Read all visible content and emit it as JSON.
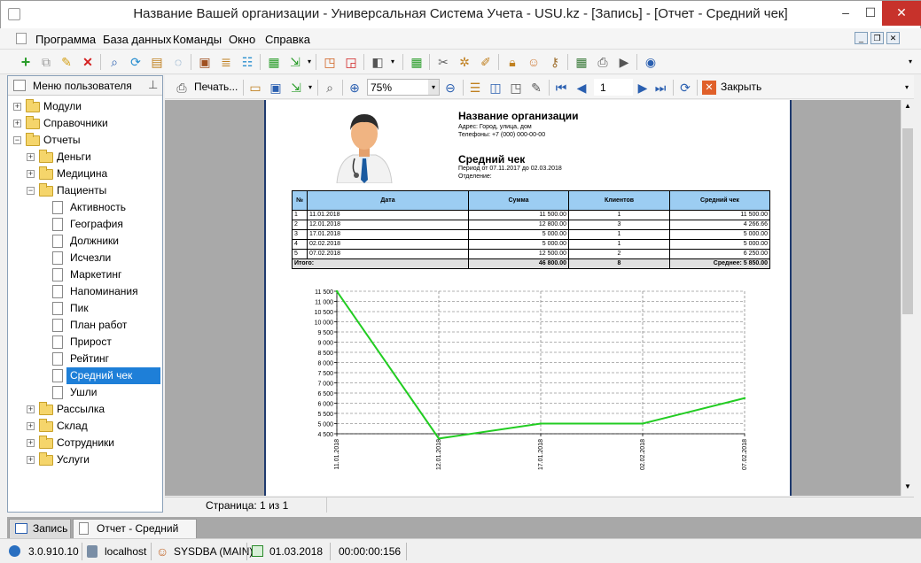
{
  "window": {
    "title": "Название Вашей организации - Универсальная Система Учета - USU.kz - [Запись] - [Отчет - Средний чек]",
    "controls": {
      "minimize": "–",
      "maximize": "☐",
      "close": "✕"
    }
  },
  "menu": [
    "Программа",
    "База данных",
    "Команды",
    "Окно",
    "Справка"
  ],
  "sidebar": {
    "title": "Меню пользователя",
    "tree": [
      {
        "label": "Модули",
        "level": 0,
        "expander": "+",
        "type": "folder"
      },
      {
        "label": "Справочники",
        "level": 0,
        "expander": "+",
        "type": "folder"
      },
      {
        "label": "Отчеты",
        "level": 0,
        "expander": "−",
        "type": "folder"
      },
      {
        "label": "Деньги",
        "level": 1,
        "expander": "+",
        "type": "folder"
      },
      {
        "label": "Медицина",
        "level": 1,
        "expander": "+",
        "type": "folder"
      },
      {
        "label": "Пациенты",
        "level": 1,
        "expander": "−",
        "type": "folder"
      },
      {
        "label": "Активность",
        "level": 2,
        "type": "doc"
      },
      {
        "label": "География",
        "level": 2,
        "type": "doc"
      },
      {
        "label": "Должники",
        "level": 2,
        "type": "doc"
      },
      {
        "label": "Исчезли",
        "level": 2,
        "type": "doc"
      },
      {
        "label": "Маркетинг",
        "level": 2,
        "type": "doc"
      },
      {
        "label": "Напоминания",
        "level": 2,
        "type": "doc"
      },
      {
        "label": "Пик",
        "level": 2,
        "type": "doc"
      },
      {
        "label": "План работ",
        "level": 2,
        "type": "doc"
      },
      {
        "label": "Прирост",
        "level": 2,
        "type": "doc"
      },
      {
        "label": "Рейтинг",
        "level": 2,
        "type": "doc"
      },
      {
        "label": "Средний чек",
        "level": 2,
        "type": "doc",
        "selected": true
      },
      {
        "label": "Ушли",
        "level": 2,
        "type": "doc"
      },
      {
        "label": "Рассылка",
        "level": 1,
        "expander": "+",
        "type": "folder"
      },
      {
        "label": "Склад",
        "level": 1,
        "expander": "+",
        "type": "folder"
      },
      {
        "label": "Сотрудники",
        "level": 1,
        "expander": "+",
        "type": "folder"
      },
      {
        "label": "Услуги",
        "level": 1,
        "expander": "+",
        "type": "folder"
      }
    ]
  },
  "report_toolbar": {
    "print_label": "Печать...",
    "zoom": "75%",
    "page_number": "1",
    "close_label": "Закрыть"
  },
  "report": {
    "org_name": "Название организации",
    "address": "Адрес: Город, улица, дом",
    "phone": "Телефоны: +7 (000) 000-00-00",
    "title": "Средний чек",
    "period": "Период от 07.11.2017 до 02.03.2018",
    "department": "Отделение:",
    "table": {
      "headers": [
        "№",
        "Дата",
        "Сумма",
        "Клиентов",
        "Средний чек"
      ],
      "rows": [
        [
          "1",
          "11.01.2018",
          "11 500.00",
          "1",
          "11 500.00"
        ],
        [
          "2",
          "12.01.2018",
          "12 800.00",
          "3",
          "4 266.66"
        ],
        [
          "3",
          "17.01.2018",
          "5 000.00",
          "1",
          "5 000.00"
        ],
        [
          "4",
          "02.02.2018",
          "5 000.00",
          "1",
          "5 000.00"
        ],
        [
          "5",
          "07.02.2018",
          "12 500.00",
          "2",
          "6 250.00"
        ]
      ],
      "total": [
        "Итого:",
        "46 800.00",
        "8",
        "Среднее: 5 850.00"
      ]
    }
  },
  "chart_data": {
    "type": "line",
    "categories": [
      "11.01.2018",
      "12.01.2018",
      "17.01.2018",
      "02.02.2018",
      "07.02.2018"
    ],
    "values": [
      11500,
      4266.66,
      5000,
      5000,
      6250
    ],
    "ylim": [
      4500,
      11500
    ],
    "yticks": [
      "4 500",
      "5 000",
      "5 500",
      "6 000",
      "6 500",
      "7 000",
      "7 500",
      "8 000",
      "8 500",
      "9 000",
      "9 500",
      "10 000",
      "10 500",
      "11 000",
      "11 500"
    ],
    "grid": true,
    "line_color": "#22cc22"
  },
  "page_status": "Страница: 1 из 1",
  "tabs": [
    "Запись",
    "Отчет - Средний чек"
  ],
  "statusbar": {
    "version": "3.0.910.10",
    "host": "localhost",
    "user": "SYSDBA (MAIN)",
    "date": "01.03.2018",
    "timer": "00:00:00:156"
  }
}
